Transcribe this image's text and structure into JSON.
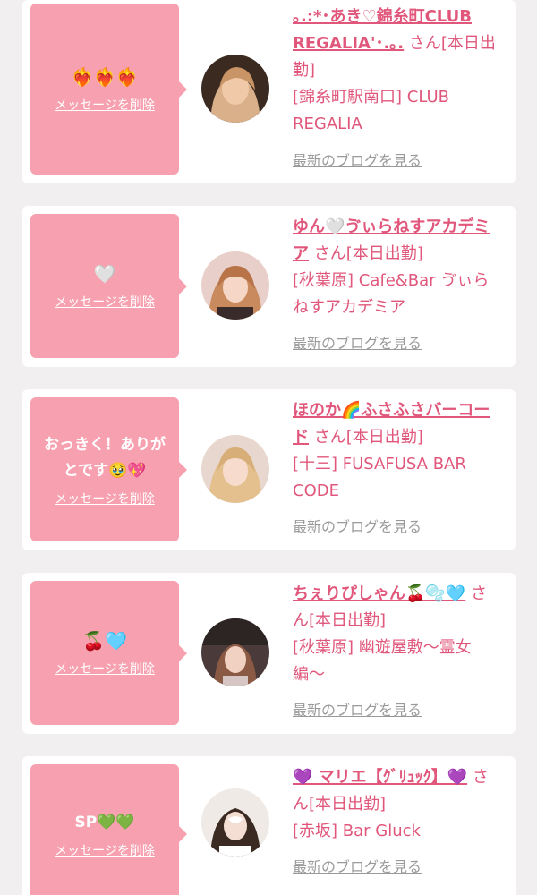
{
  "messages": [
    {
      "bubble_text": "❤️‍🔥❤️‍🔥❤️‍🔥",
      "delete_label": "メッセージを削除",
      "name": "｡.:*･あき♡錦糸町CLUB REGALIA'･.｡.",
      "status": "さん[本日出勤]",
      "shop": "[錦糸町駅南口] CLUB REGALIA",
      "blog_label": "最新のブログを見る"
    },
    {
      "bubble_text": "🤍",
      "delete_label": "メッセージを削除",
      "name": "ゆん🤍ゔぃらねすアカデミア",
      "status": "さん[本日出勤]",
      "shop": "[秋葉原] Cafe&Bar ゔぃらねすアカデミア",
      "blog_label": "最新のブログを見る"
    },
    {
      "bubble_text": "おっきく！ありがとです🥹💖",
      "delete_label": "メッセージを削除",
      "name": "ほのか🌈ふさふさバーコード",
      "status": "さん[本日出勤]",
      "shop": "[十三] FUSAFUSA BAR CODE",
      "blog_label": "最新のブログを見る"
    },
    {
      "bubble_text": "🍒🩵",
      "delete_label": "メッセージを削除",
      "name": "ちぇりぴしゃん🍒🫧🩵",
      "status": "さん[本日出勤]",
      "shop": "[秋葉原] 幽遊屋敷〜霊女編〜",
      "blog_label": "最新のブログを見る"
    },
    {
      "bubble_text": "SP💚💚",
      "delete_label": "メッセージを削除",
      "name": "💜 マリエ【ｸﾞﾘｭｯｸ】💜",
      "status": "さん[本日出勤]",
      "shop": "[赤坂] Bar Gluck",
      "blog_label": "最新のブログを見る"
    }
  ],
  "colors": {
    "background": "#f2eff0",
    "card": "#ffffff",
    "bubble": "#f7a1b0",
    "accent_pink": "#e0577b",
    "muted_link": "#9a9a9a"
  }
}
